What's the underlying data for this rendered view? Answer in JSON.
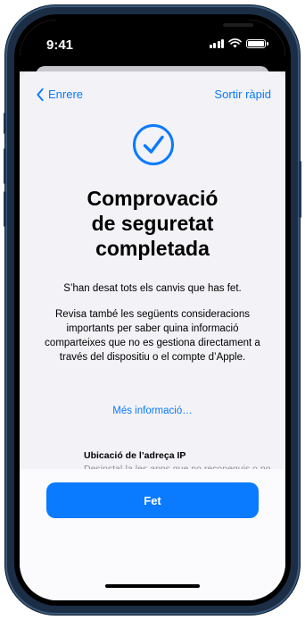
{
  "status_bar": {
    "time": "9:41"
  },
  "nav": {
    "back_label": "Enrere",
    "quick_exit_label": "Sortir ràpid"
  },
  "main": {
    "title_lines": [
      "Comprovació",
      "de seguretat",
      "completada"
    ],
    "saved_text": "S’han desat tots els canvis que has fet.",
    "review_text": "Revisa també les següents consideracions importants per saber quina informació comparteixes que no es gestiona directament a través del dispositiu o el compte d’Apple.",
    "more_info_link": "Més informació…",
    "ip_item": {
      "title": "Ubicació de l’adreça IP",
      "description": "Desinstal·la les apps que no reconeguis o no facis servir. Les apps es poden"
    }
  },
  "footer": {
    "done_label": "Fet"
  },
  "colors": {
    "accent": "#0a7aff",
    "frame": "#1b2e45"
  },
  "icons": [
    "chevron-left-icon",
    "checkmark-circle-icon",
    "globe-icon",
    "signal-icon",
    "wifi-icon",
    "battery-icon"
  ]
}
